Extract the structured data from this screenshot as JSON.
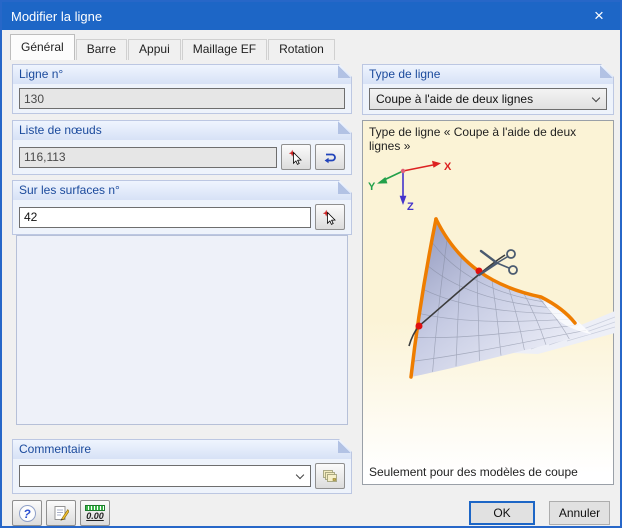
{
  "window": {
    "title": "Modifier la ligne",
    "close_glyph": "×"
  },
  "tabs": [
    {
      "label": "Général",
      "active": true
    },
    {
      "label": "Barre",
      "active": false
    },
    {
      "label": "Appui",
      "active": false
    },
    {
      "label": "Maillage EF",
      "active": false
    },
    {
      "label": "Rotation",
      "active": false
    }
  ],
  "general_tab": {
    "line_number": {
      "label": "Ligne n°",
      "value": "130"
    },
    "node_list": {
      "label": "Liste de nœuds",
      "value": "116,113"
    },
    "surfaces": {
      "label": "Sur les surfaces n°",
      "value": "42"
    },
    "comment": {
      "label": "Commentaire",
      "value": ""
    }
  },
  "line_type": {
    "label": "Type de ligne",
    "selected": "Coupe à l'aide de deux lignes"
  },
  "info_panel": {
    "heading": "Type de ligne « Coupe à l'aide de deux lignes »",
    "axis_labels": {
      "x": "X",
      "y": "Y",
      "z": "Z"
    },
    "footer_note": "Seulement pour des modèles de coupe"
  },
  "footer": {
    "ok_label": "OK",
    "cancel_label": "Annuler",
    "units_text": "0.00"
  },
  "colors": {
    "titlebar": "#1d66c6",
    "group_label": "#1b4a9c",
    "surface_edge_orange": "#ee7d00",
    "axis_x_red": "#dd2222",
    "axis_y_green": "#22a04a",
    "axis_z_blue": "#4433cc",
    "cut_point_red": "#e01010",
    "info_bg": "#fbf3d6"
  }
}
